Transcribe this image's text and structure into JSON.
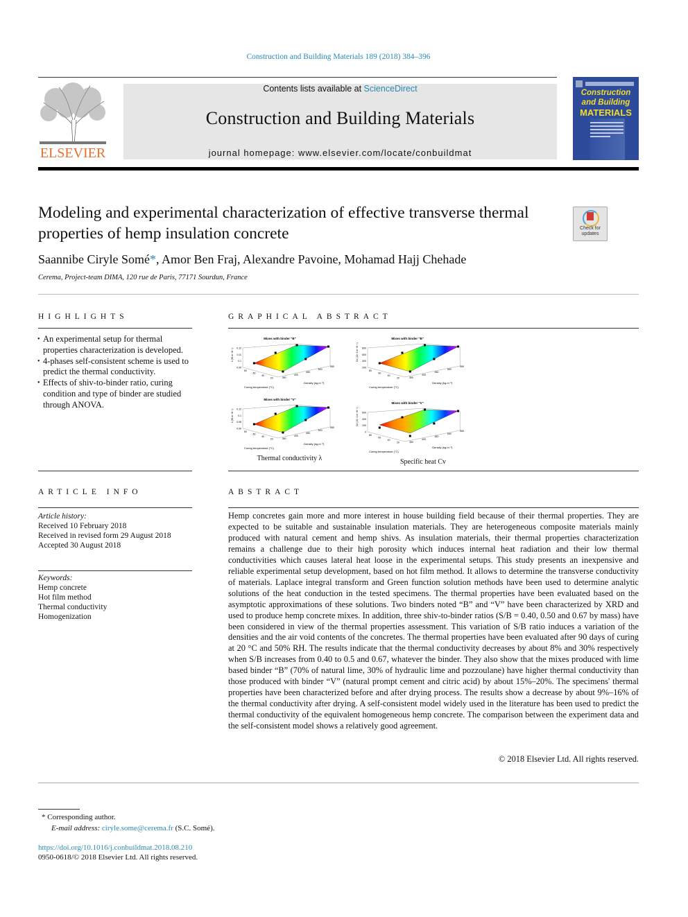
{
  "running_header": "Construction and Building Materials 189 (2018) 384–396",
  "masthead": {
    "publisher": "ELSEVIER",
    "contents_prefix": "Contents lists available at ",
    "contents_link": "ScienceDirect",
    "journal_title": "Construction and Building Materials",
    "homepage": "journal homepage: www.elsevier.com/locate/conbuildmat",
    "cover": {
      "line1": "Construction",
      "line2": "and Building",
      "line3": "MATERIALS",
      "bg_color": "#2d4b9a",
      "text_color": "#f4dc2a"
    }
  },
  "article": {
    "title": "Modeling and experimental characterization of effective transverse thermal properties of hemp insulation concrete",
    "crossmark": "Check for updates",
    "authors": [
      {
        "name": "Saannibe Ciryle Somé",
        "mark": "*"
      },
      {
        "name": ", Amor Ben Fraj, Alexandre Pavoine, Mohamad Hajj Chehade",
        "mark": ""
      }
    ],
    "affiliation": "Cerema, Project-team DIMA, 120 rue de Paris, 77171 Sourdun, France"
  },
  "highlights": {
    "heading": "HIGHLIGHTS",
    "items": [
      "An experimental setup for thermal properties characterization is developed.",
      "4-phases self-consistent scheme is used to predict the thermal conductivity.",
      "Effects of shiv-to-binder ratio, curing condition and type of binder are studied through ANOVA."
    ]
  },
  "graphical_abstract": {
    "heading": "GRAPHICAL ABSTRACT",
    "captions": [
      "Thermal conductivity λ",
      "Specific heat Cv"
    ]
  },
  "chart_data": [
    {
      "type": "surface3d",
      "title": "Mixes with binder \"B\"",
      "zlabel": "λ (W.m⁻¹K⁻¹)",
      "xlabel": "Density (kg.m⁻³)",
      "ylabel": "Curing temperature (°C)",
      "z_ticks": [
        "0.09",
        "0.1",
        "0.11",
        "0.12"
      ],
      "x_ticks": [
        "350",
        "400",
        "450",
        "500",
        "550"
      ],
      "y_ticks": [
        "20",
        "40",
        "60",
        "80"
      ],
      "zlim": [
        0.09,
        0.12
      ]
    },
    {
      "type": "surface3d",
      "title": "Mixes with binder \"B\"",
      "zlabel": "Cv (10³ J.m⁻³K⁻¹)",
      "xlabel": "Density (kg.m⁻³)",
      "ylabel": "Curing temperature (°C)",
      "z_ticks": [
        "200",
        "400",
        "600",
        "800"
      ],
      "x_ticks": [
        "350",
        "400",
        "450",
        "500",
        "550"
      ],
      "y_ticks": [
        "20",
        "40",
        "60",
        "80"
      ],
      "zlim": [
        200,
        800
      ]
    },
    {
      "type": "surface3d",
      "title": "Mixes with binder \"V\"",
      "zlabel": "λ (W.m⁻¹K⁻¹)",
      "xlabel": "Density (kg.m⁻³)",
      "ylabel": "Curing temperature (°C)",
      "z_ticks": [
        "0.06",
        "0.08",
        "0.1",
        "0.12"
      ],
      "x_ticks": [
        "350",
        "400",
        "450",
        "500",
        "550"
      ],
      "y_ticks": [
        "20",
        "40",
        "60",
        "80"
      ],
      "zlim": [
        0.06,
        0.12
      ]
    },
    {
      "type": "surface3d",
      "title": "Mixes with binder \"V\"",
      "zlabel": "Cv (10³ J.m⁻³K⁻¹)",
      "xlabel": "Density (kg.m⁻³)",
      "ylabel": "Curing temperature (°C)",
      "z_ticks": [
        "0",
        "200",
        "400",
        "600"
      ],
      "x_ticks": [
        "350",
        "400",
        "450",
        "500",
        "550"
      ],
      "y_ticks": [
        "20",
        "40",
        "60",
        "80"
      ],
      "zlim": [
        0,
        600
      ]
    }
  ],
  "article_info": {
    "heading": "ARTICLE INFO",
    "history_label": "Article history:",
    "history": [
      "Received 10 February 2018",
      "Received in revised form 29 August 2018",
      "Accepted 30 August 2018"
    ],
    "keywords_label": "Keywords:",
    "keywords": [
      "Hemp concrete",
      "Hot film method",
      "Thermal conductivity",
      "Homogenization"
    ]
  },
  "abstract": {
    "heading": "ABSTRACT",
    "text": "Hemp concretes gain more and more interest in house building field because of their thermal properties. They are expected to be suitable and sustainable insulation materials. They are heterogeneous composite materials mainly produced with natural cement and hemp shivs. As insulation materials, their thermal properties characterization remains a challenge due to their high porosity which induces internal heat radiation and their low thermal conductivities which causes lateral heat loose in the experimental setups. This study presents an inexpensive and reliable experimental setup development, based on hot film method. It allows to determine the transverse conductivity of materials. Laplace integral transform and Green function solution methods have been used to determine analytic solutions of the heat conduction in the tested specimens. The thermal properties have been evaluated based on the asymptotic approximations of these solutions. Two binders noted “B” and “V” have been characterized by XRD and used to produce hemp concrete mixes. In addition, three shiv-to-binder ratios (S/B = 0.40, 0.50 and 0.67 by mass) have been considered in view of the thermal properties assessment. This variation of S/B ratio induces a variation of the densities and the air void contents of the concretes. The thermal properties have been evaluated after 90 days of curing at 20 °C and 50% RH. The results indicate that the thermal conductivity decreases by about 8% and 30% respectively when S/B increases from 0.40 to 0.5 and 0.67, whatever the binder. They also show that the mixes produced with lime based binder “B” (70% of natural lime, 30% of hydraulic lime and pozzoulane) have higher thermal conductivity than those produced with binder “V” (natural prompt cement and citric acid) by about 15%–20%. The specimens' thermal properties have been characterized before and after drying process. The results show a decrease by about 9%–16% of the thermal conductivity after drying. A self-consistent model widely used in the literature has been used to predict the thermal conductivity of the equivalent homogeneous hemp concrete. The comparison between the experiment data and the self-consistent model shows a relatively good agreement.",
    "copyright": "© 2018 Elsevier Ltd. All rights reserved."
  },
  "footnotes": {
    "corresponding_mark": "*",
    "corresponding": "Corresponding author.",
    "email_label": "E-mail address: ",
    "email": "ciryle.some@cerema.fr",
    "email_suffix": " (S.C. Somé).",
    "doi": "https://doi.org/10.1016/j.conbuildmat.2018.08.210",
    "issn": "0950-0618/© 2018 Elsevier Ltd. All rights reserved."
  },
  "colors": {
    "link": "#2a8ab5",
    "elsevier_orange": "#e8702a",
    "banner_bg": "#e6e6e6"
  }
}
